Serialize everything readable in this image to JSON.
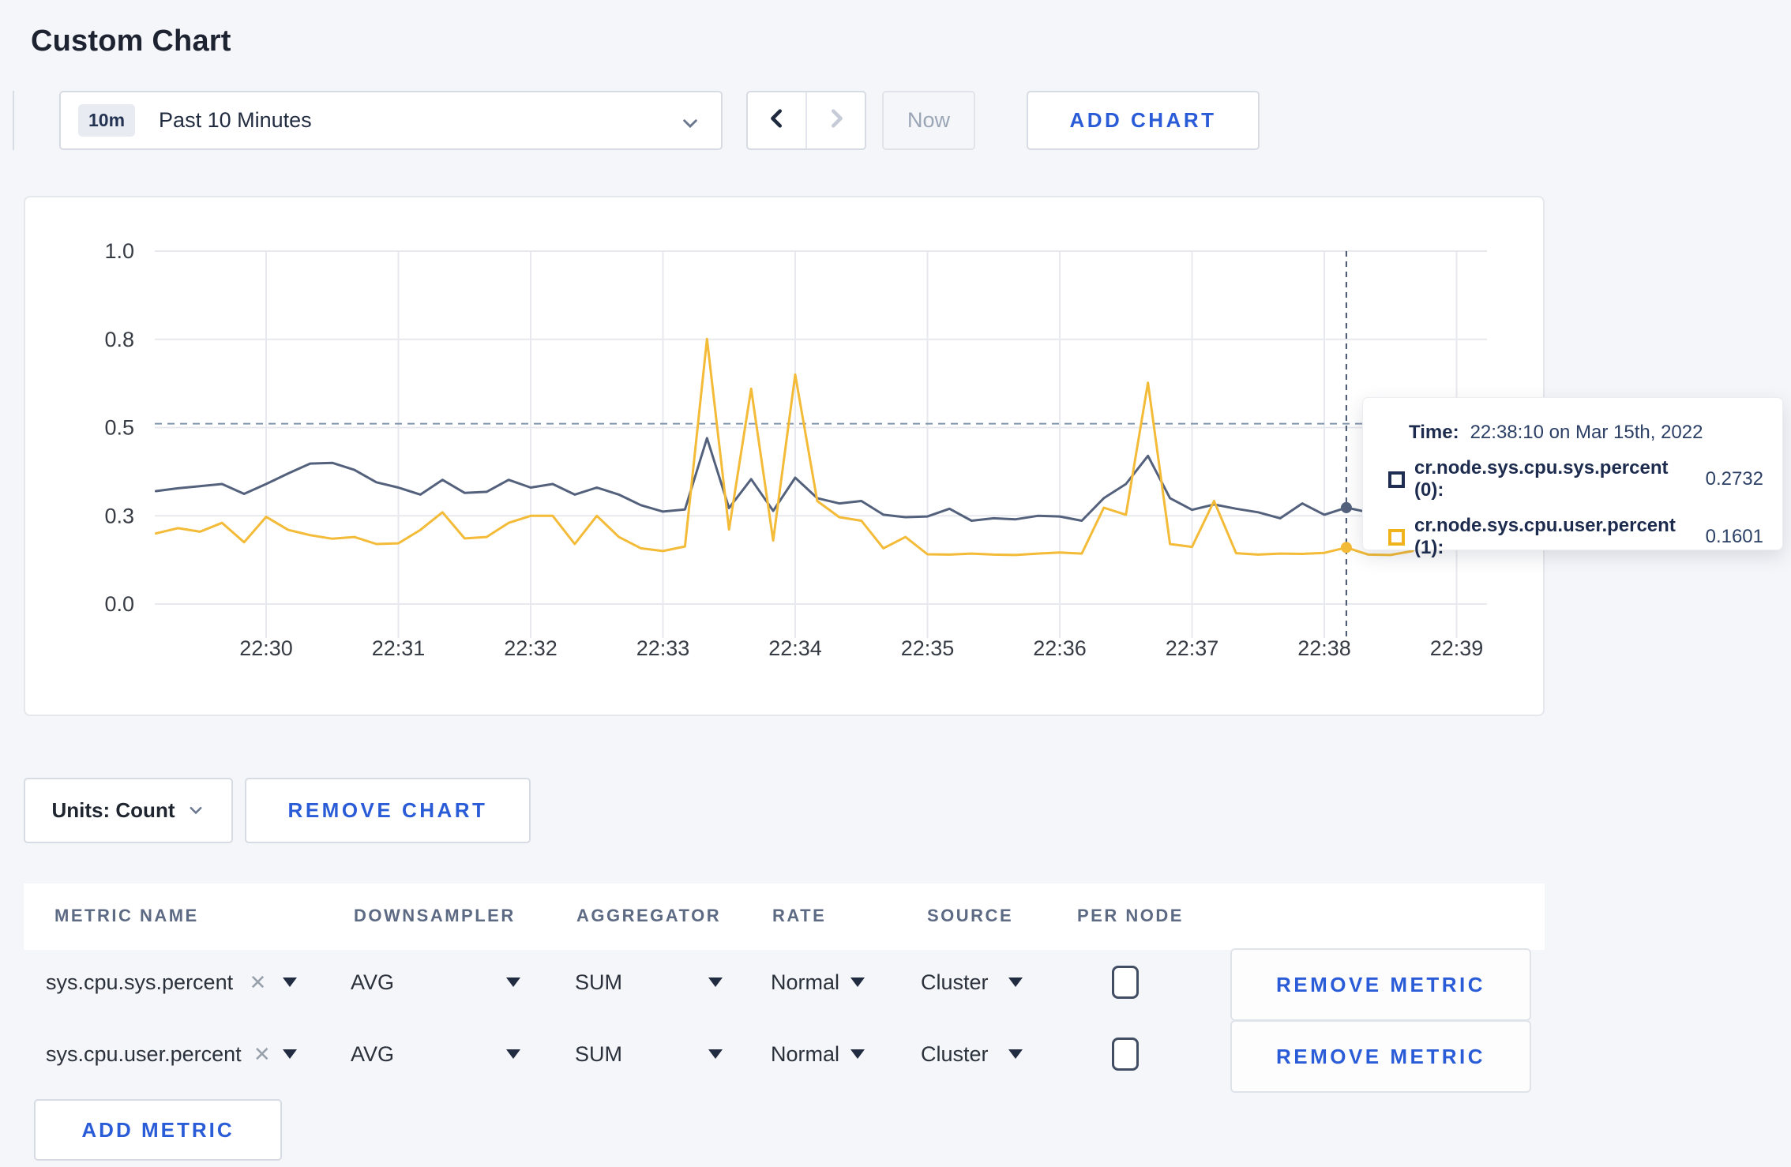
{
  "page": {
    "title": "Custom Chart",
    "background": "#f5f6fa"
  },
  "toolbar": {
    "range_badge": "10m",
    "range_label": "Past 10 Minutes",
    "chevron_icon": "chevron-down",
    "prev_icon": "chevron-left",
    "next_icon": "chevron-right",
    "now_label": "Now",
    "add_chart_label": "ADD CHART",
    "accent_color": "#2a5cd8"
  },
  "chart_data": {
    "type": "line",
    "title": "",
    "xlabel": "",
    "ylabel": "",
    "ylim": [
      0,
      1
    ],
    "grid": true,
    "legend_position": "tooltip",
    "y_ticks": [
      {
        "value": 0,
        "label": "0.0"
      },
      {
        "value": 0.25,
        "label": "0.3"
      },
      {
        "value": 0.5,
        "label": "0.5"
      },
      {
        "value": 0.75,
        "label": "0.8"
      },
      {
        "value": 1,
        "label": "1.0"
      }
    ],
    "x_ticks": [
      "22:30",
      "22:31",
      "22:32",
      "22:33",
      "22:34",
      "22:35",
      "22:36",
      "22:37",
      "22:38",
      "22:39"
    ],
    "threshold_value": 0.511,
    "crosshair": {
      "time": "22:38:10",
      "values": [
        0.2732,
        0.1601
      ]
    },
    "series": [
      {
        "name": "cr.node.sys.cpu.sys.percent",
        "color": "#54617c",
        "start": "22:29:10",
        "step_seconds": 10,
        "values": [
          0.32,
          0.328,
          0.334,
          0.34,
          0.312,
          0.34,
          0.37,
          0.398,
          0.4,
          0.38,
          0.345,
          0.33,
          0.31,
          0.352,
          0.315,
          0.318,
          0.352,
          0.33,
          0.34,
          0.31,
          0.33,
          0.31,
          0.28,
          0.262,
          0.268,
          0.47,
          0.272,
          0.354,
          0.264,
          0.358,
          0.3,
          0.285,
          0.292,
          0.253,
          0.246,
          0.248,
          0.27,
          0.236,
          0.243,
          0.24,
          0.25,
          0.248,
          0.236,
          0.3,
          0.34,
          0.42,
          0.3,
          0.267,
          0.282,
          0.27,
          0.26,
          0.243,
          0.285,
          0.253,
          0.2732,
          0.26,
          0.27,
          0.296,
          0.31,
          0.3,
          0.305
        ]
      },
      {
        "name": "cr.node.sys.cpu.user.percent",
        "color": "#f3bb37",
        "start": "22:29:10",
        "step_seconds": 10,
        "values": [
          0.2,
          0.215,
          0.205,
          0.23,
          0.175,
          0.247,
          0.21,
          0.195,
          0.185,
          0.19,
          0.17,
          0.172,
          0.21,
          0.26,
          0.186,
          0.19,
          0.23,
          0.25,
          0.25,
          0.17,
          0.25,
          0.19,
          0.158,
          0.15,
          0.163,
          0.751,
          0.211,
          0.61,
          0.18,
          0.65,
          0.292,
          0.246,
          0.236,
          0.158,
          0.19,
          0.141,
          0.14,
          0.143,
          0.14,
          0.139,
          0.143,
          0.146,
          0.143,
          0.273,
          0.253,
          0.627,
          0.17,
          0.162,
          0.292,
          0.144,
          0.14,
          0.143,
          0.142,
          0.145,
          0.1601,
          0.14,
          0.139,
          0.15,
          0.22,
          0.28,
          0.24
        ]
      }
    ]
  },
  "tooltip": {
    "time_label": "Time:",
    "time_value": "22:38:10 on Mar 15th, 2022",
    "rows": [
      {
        "label": "cr.node.sys.cpu.sys.percent (0):",
        "value": "0.2732",
        "color": "#1e2d51"
      },
      {
        "label": "cr.node.sys.cpu.user.percent (1):",
        "value": "0.1601",
        "color": "#f1b31b"
      }
    ]
  },
  "units_bar": {
    "units_label": "Units: Count",
    "remove_chart_label": "REMOVE CHART"
  },
  "metrics_table": {
    "headers": [
      "METRIC NAME",
      "DOWNSAMPLER",
      "AGGREGATOR",
      "RATE",
      "SOURCE",
      "PER NODE"
    ],
    "clear_icon": "✕",
    "rows": [
      {
        "metric": "sys.cpu.sys.percent",
        "downsampler": "AVG",
        "aggregator": "SUM",
        "rate": "Normal",
        "source": "Cluster",
        "per_node_checked": false,
        "remove_label": "REMOVE METRIC"
      },
      {
        "metric": "sys.cpu.user.percent",
        "downsampler": "AVG",
        "aggregator": "SUM",
        "rate": "Normal",
        "source": "Cluster",
        "per_node_checked": false,
        "remove_label": "REMOVE METRIC"
      }
    ],
    "add_metric_label": "ADD METRIC"
  }
}
